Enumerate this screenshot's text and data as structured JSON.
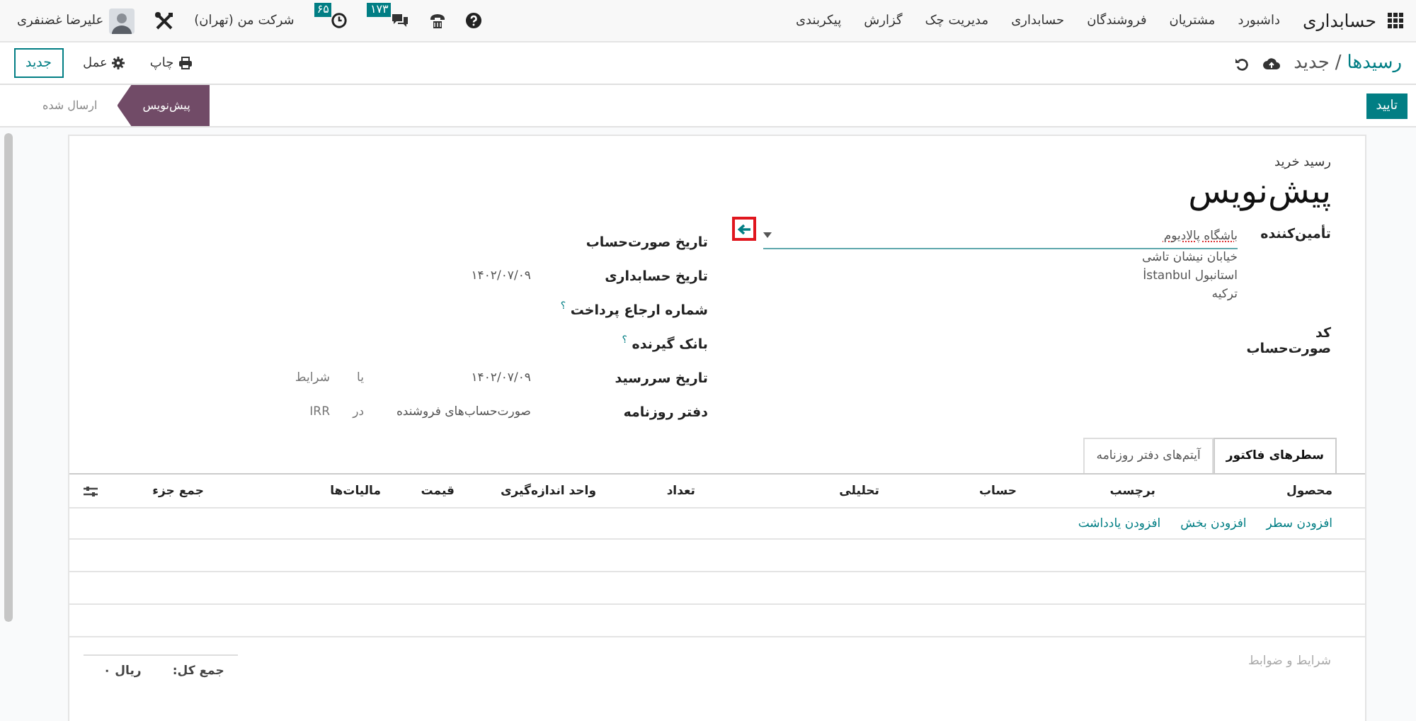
{
  "navbar": {
    "app_name": "حسابداری",
    "menu": [
      "داشبورد",
      "مشتریان",
      "فروشندگان",
      "حسابداری",
      "مدیریت چک",
      "گزارش",
      "پیکربندی"
    ],
    "chat_count": "۱۷۳",
    "activity_count": "۶۵",
    "company": "شرکت من (تهران)",
    "user": "علیرضا غضنفری"
  },
  "control_panel": {
    "breadcrumb": "رسیدها",
    "separator": "/",
    "current": "جدید",
    "actions": [
      "چاپ",
      "عمل"
    ],
    "new_button": "جدید"
  },
  "confirm_button": "تایید",
  "statusbar": [
    {
      "label": "پیش‌نویس",
      "selected": true
    },
    {
      "label": "ارسال شده",
      "selected": false
    }
  ],
  "sheet": {
    "type_label": "رسید خرید",
    "title": "پیش‌نویس",
    "supplier": {
      "label": "تأمین‌کننده",
      "value": "باشگاه پالادیوم",
      "address": [
        "خیابان نیشان تاشی",
        "استانبول İstanbul",
        "ترکیه"
      ],
      "arrow_highlighted": true
    },
    "bill_reference": {
      "label": "کد صورت‌حساب"
    },
    "fields": [
      {
        "label": "تاریخ صورت‌حساب"
      },
      {
        "label": "تاریخ حسابداری",
        "value": "۱۴۰۲/۰۷/۰۹"
      },
      {
        "label": "شماره ارجاع پرداخت",
        "help": "؟"
      },
      {
        "label": "بانک گیرنده",
        "help": "؟"
      },
      {
        "label": "تاریخ سررسید",
        "value": "۱۴۰۲/۰۷/۰۹",
        "joiner": "یا",
        "extra": "شرایط"
      },
      {
        "label": "دفتر روزنامه",
        "value": "صورت‌حساب‌های فروشنده",
        "joiner": "در",
        "extra": "IRR"
      }
    ],
    "tabs": [
      {
        "label": "سطرهای فاکتور",
        "selected": true
      },
      {
        "label": "آیتم‌های دفتر روزنامه",
        "selected": false
      }
    ],
    "columns": [
      "محصول",
      "برچسب",
      "حساب",
      "تحلیلی",
      "تعداد",
      "واحد اندازه‌گیری",
      "قیمت",
      "مالیات‌ها",
      "جمع جزء"
    ],
    "add_links": [
      "افزودن سطر",
      "افزودن بخش",
      "افزودن یادداشت"
    ],
    "terms_placeholder": "شرایط و ضوابط",
    "total_label": "جمع کل:",
    "total_value": "ریال ۰"
  }
}
